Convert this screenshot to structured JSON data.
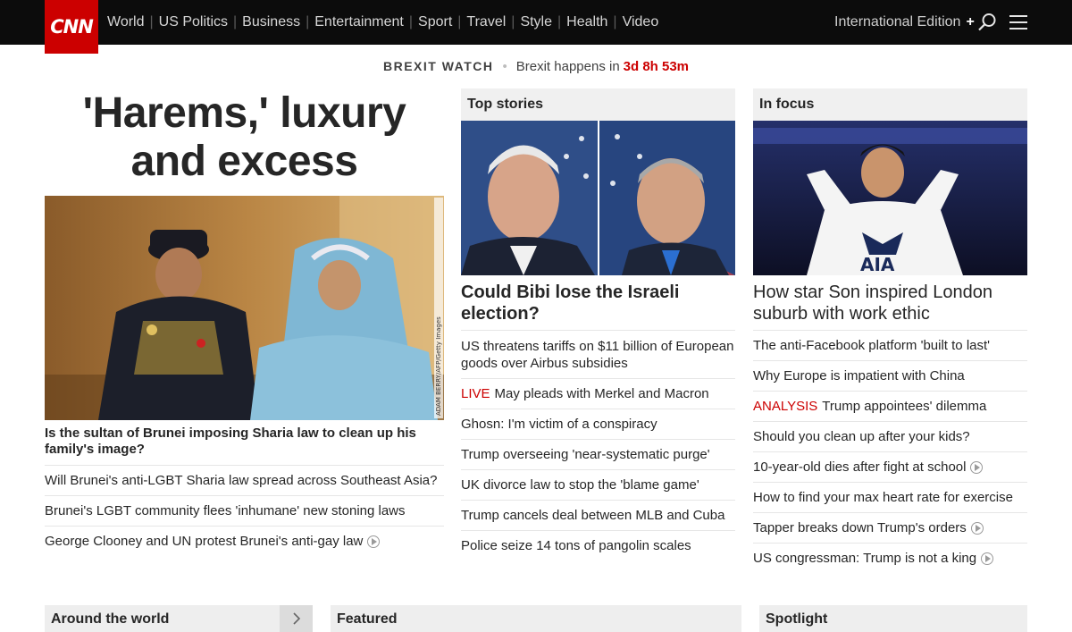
{
  "nav": {
    "logo": "CNN",
    "links": [
      "World",
      "US Politics",
      "Business",
      "Entertainment",
      "Sport",
      "Travel",
      "Style",
      "Health",
      "Video"
    ],
    "edition": "International Edition",
    "edition_plus": "+"
  },
  "brexit": {
    "label": "BREXIT WATCH",
    "text": "Brexit happens in",
    "countdown": "3d 8h 53m"
  },
  "hero": {
    "title": "'Harems,' luxury and excess",
    "image_credit": "ADAM BERRY/AFP/Getty Images",
    "caption": "Is the sultan of Brunei imposing Sharia law to clean up his family's image?",
    "links": [
      {
        "text": "Will Brunei's anti-LGBT Sharia law spread across Southeast Asia?",
        "video": false
      },
      {
        "text": "Brunei's LGBT community flees 'inhumane' new stoning laws",
        "video": false
      },
      {
        "text": "George Clooney and UN protest Brunei's anti-gay law",
        "video": true
      }
    ]
  },
  "top_stories": {
    "header": "Top stories",
    "title": "Could Bibi lose the Israeli election?",
    "items": [
      {
        "tag": "",
        "text": "US threatens tariffs on $11 billion of European goods over Airbus subsidies"
      },
      {
        "tag": "LIVE",
        "text": "May pleads with Merkel and Macron"
      },
      {
        "tag": "",
        "text": "Ghosn: I'm victim of a conspiracy"
      },
      {
        "tag": "",
        "text": "Trump overseeing 'near-systematic purge'"
      },
      {
        "tag": "",
        "text": "UK divorce law to stop the 'blame game'"
      },
      {
        "tag": "",
        "text": "Trump cancels deal between MLB and Cuba"
      },
      {
        "tag": "",
        "text": "Police seize 14 tons of pangolin scales"
      }
    ]
  },
  "in_focus": {
    "header": "In focus",
    "title": "How star Son inspired London suburb with work ethic",
    "items": [
      {
        "tag": "",
        "text": "The anti-Facebook platform 'built to last'",
        "video": false
      },
      {
        "tag": "",
        "text": "Why Europe is impatient with China",
        "video": false
      },
      {
        "tag": "ANALYSIS",
        "text": "Trump appointees' dilemma",
        "video": false
      },
      {
        "tag": "",
        "text": "Should you clean up after your kids?",
        "video": false
      },
      {
        "tag": "",
        "text": "10-year-old dies after fight at school",
        "video": true
      },
      {
        "tag": "",
        "text": "How to find your max heart rate for exercise",
        "video": false
      },
      {
        "tag": "",
        "text": "Tapper breaks down Trump's orders",
        "video": true
      },
      {
        "tag": "",
        "text": "US congressman: Trump is not a king",
        "video": true
      }
    ]
  },
  "bottom": {
    "around": "Around the world",
    "featured": "Featured",
    "spotlight": "Spotlight"
  },
  "colors": {
    "brand": "#cc0000",
    "nav_bg": "#0c0c0c",
    "header_bg": "#f0f0f0"
  }
}
